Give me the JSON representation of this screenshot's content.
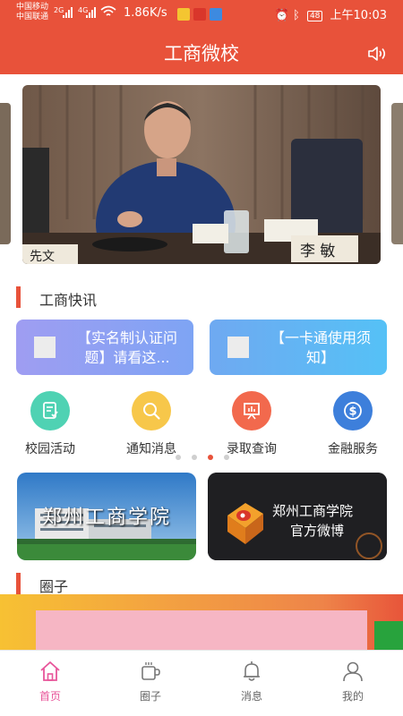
{
  "status_bar": {
    "carrier1": "中国移动",
    "carrier2": "中国联通",
    "net1": "2G",
    "net2": "4G",
    "speed": "1.86K/s",
    "battery": "48",
    "time": "上午10:03"
  },
  "header": {
    "title": "工商微校"
  },
  "banner": {
    "nameplate_left": "先文",
    "nameplate_right": "李 敏"
  },
  "news_section": {
    "title": "工商快讯",
    "cards": [
      {
        "text": "【实名制认证问题】请看这..."
      },
      {
        "text": "【一卡通使用须知】"
      }
    ]
  },
  "services": [
    {
      "label": "校园活动",
      "icon": "campus-activity-icon",
      "color": "#4fd2b3"
    },
    {
      "label": "通知消息",
      "icon": "search-icon",
      "color": "#f7c74a"
    },
    {
      "label": "录取查询",
      "icon": "presentation-icon",
      "color": "#f2694d"
    },
    {
      "label": "金融服务",
      "icon": "dollar-icon",
      "color": "#3d7fdb"
    }
  ],
  "pager": {
    "count": 4,
    "active": 3
  },
  "promos": {
    "left_text": "郑州工商学院",
    "right_line1": "郑州工商学院",
    "right_line2": "官方微博"
  },
  "circle_section": {
    "title": "圈子"
  },
  "tabbar": {
    "tabs": [
      {
        "label": "首页",
        "icon": "home-icon"
      },
      {
        "label": "圈子",
        "icon": "cup-icon"
      },
      {
        "label": "消息",
        "icon": "bell-icon"
      },
      {
        "label": "我的",
        "icon": "user-icon"
      }
    ],
    "active": 0
  },
  "colors": {
    "brand": "#e8523a",
    "active_tab": "#e8559a"
  }
}
